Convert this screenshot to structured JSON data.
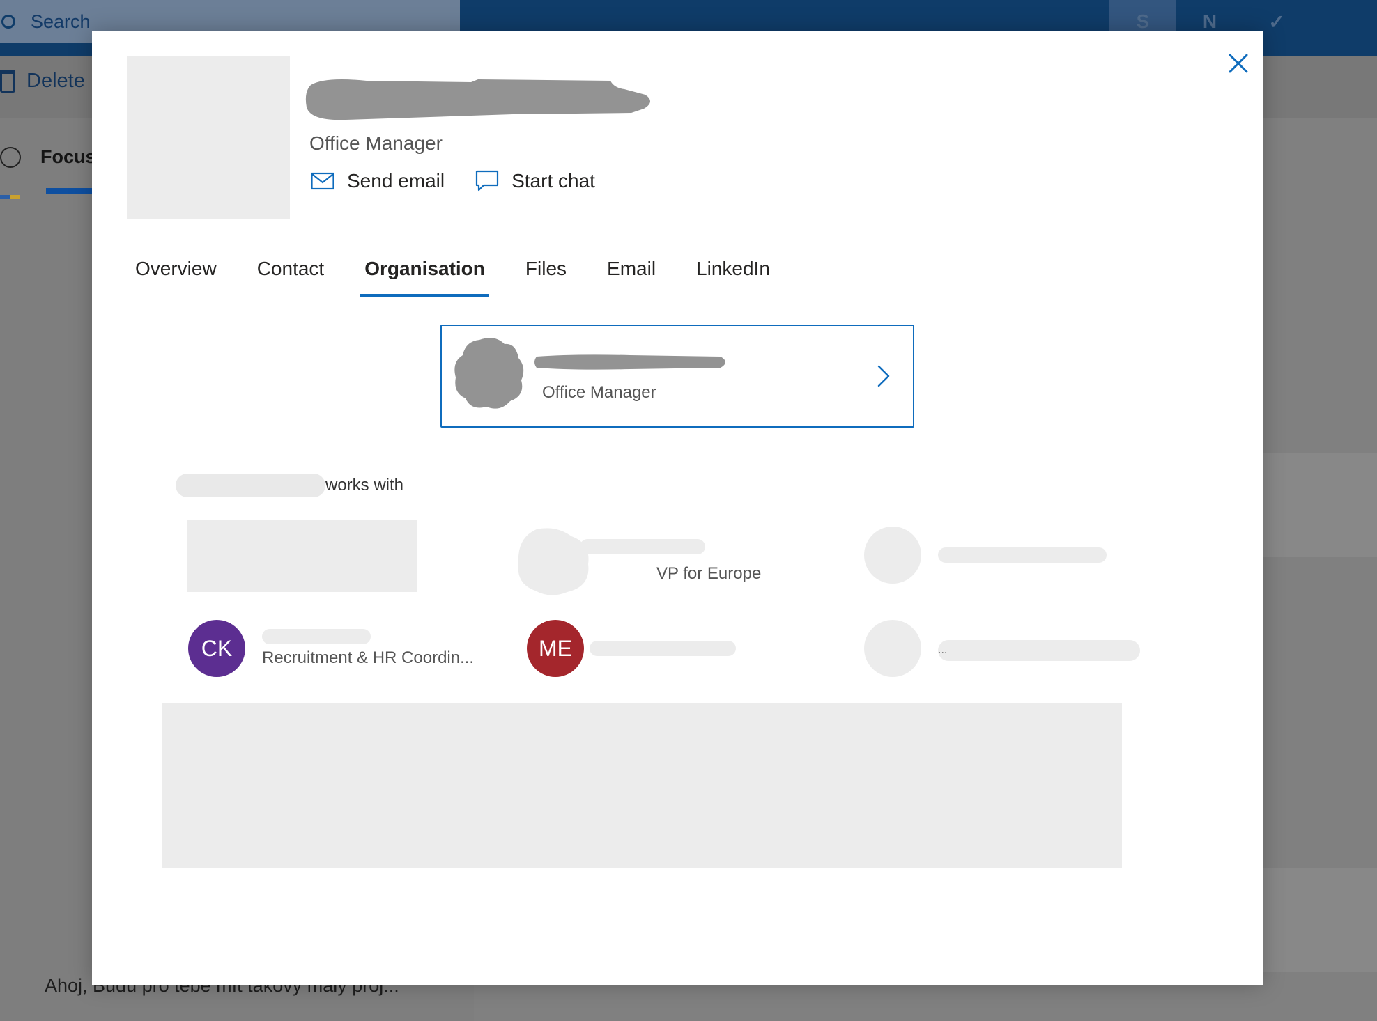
{
  "background": {
    "search_label": "Search",
    "delete_label": "Delete",
    "focused_label": "Focus",
    "snippet_text": "Ahoj, Budu pro tebe mít takový malý proj..."
  },
  "profile": {
    "job_title": "Office Manager",
    "actions": {
      "send_email": "Send email",
      "start_chat": "Start chat"
    },
    "tabs": [
      {
        "label": "Overview"
      },
      {
        "label": "Contact"
      },
      {
        "label": "Organisation",
        "active": true
      },
      {
        "label": "Files"
      },
      {
        "label": "Email"
      },
      {
        "label": "LinkedIn"
      }
    ]
  },
  "organisation": {
    "manager": {
      "title": "Office Manager"
    },
    "works_with_label": "works with",
    "colleagues": [
      {
        "initials": "",
        "title": "",
        "avatar_color": "#ececec"
      },
      {
        "initials": "",
        "title": "VP for Europe",
        "avatar_color": "#9a9a9a"
      },
      {
        "initials": "",
        "title": "",
        "avatar_color": "#ececec"
      },
      {
        "initials": "CK",
        "title": "Recruitment & HR Coordin...",
        "avatar_color": "#5c2e91"
      },
      {
        "initials": "ME",
        "title": "",
        "avatar_color": "#a4262c"
      },
      {
        "initials": "",
        "title": "...",
        "avatar_color": "#ececec"
      }
    ]
  },
  "colors": {
    "accent": "#0f6cbd",
    "ck_avatar": "#5c2e91",
    "me_avatar": "#a4262c"
  },
  "icons": {
    "close": "close-icon",
    "mail": "mail-icon",
    "chat": "chat-icon",
    "chevron": "chevron-right-icon"
  }
}
